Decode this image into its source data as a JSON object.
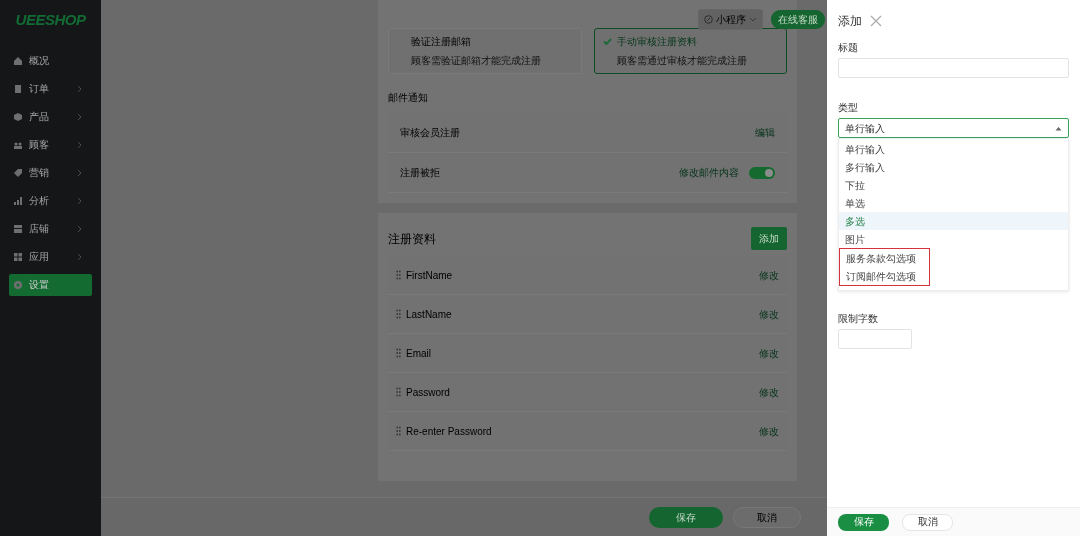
{
  "sidebar": {
    "logo": "UEESHOP",
    "items": [
      {
        "label": "概况",
        "expandable": false,
        "selected": false
      },
      {
        "label": "订单",
        "expandable": true,
        "selected": false
      },
      {
        "label": "产品",
        "expandable": true,
        "selected": false
      },
      {
        "label": "顾客",
        "expandable": true,
        "selected": false
      },
      {
        "label": "营销",
        "expandable": true,
        "selected": false
      },
      {
        "label": "分析",
        "expandable": true,
        "selected": false
      },
      {
        "label": "店铺",
        "expandable": true,
        "selected": false
      },
      {
        "label": "应用",
        "expandable": true,
        "selected": false
      },
      {
        "label": "设置",
        "expandable": false,
        "selected": true
      }
    ]
  },
  "top_bar": {
    "mini_program": "小程序",
    "online_button": "在线客服"
  },
  "review_options": [
    {
      "title": "验证注册邮箱",
      "description": "顾客需验证邮箱才能完成注册",
      "selected": false
    },
    {
      "title": "手动审核注册资料",
      "description": "顾客需通过审核才能完成注册",
      "selected": true
    }
  ],
  "email_notice": {
    "heading": "邮件通知",
    "rows": [
      {
        "label": "审核会员注册",
        "kind": "link",
        "action": "编辑"
      },
      {
        "label": "注册被拒",
        "kind": "toggle",
        "action": "修改邮件内容",
        "on": true
      }
    ]
  },
  "registration_fields": {
    "title": "注册资料",
    "add_button": "添加",
    "rows": [
      {
        "label": "FirstName",
        "action": "修改"
      },
      {
        "label": "LastName",
        "action": "修改"
      },
      {
        "label": "Email",
        "action": "修改"
      },
      {
        "label": "Password",
        "action": "修改"
      },
      {
        "label": "Re-enter Password",
        "action": "修改"
      }
    ]
  },
  "page_footer": {
    "save": "保存",
    "cancel": "取消"
  },
  "drawer": {
    "title": "添加",
    "fields": [
      {
        "label": "标题",
        "kind": "text"
      },
      {
        "label": "类型",
        "kind": "select",
        "value": "单行输入",
        "options": [
          {
            "label": "单行输入",
            "highlighted": false,
            "boxed": false
          },
          {
            "label": "多行输入",
            "highlighted": false,
            "boxed": false
          },
          {
            "label": "下拉",
            "highlighted": false,
            "boxed": false
          },
          {
            "label": "单选",
            "highlighted": false,
            "boxed": false
          },
          {
            "label": "多选",
            "highlighted": true,
            "boxed": false
          },
          {
            "label": "图片",
            "highlighted": false,
            "boxed": false
          },
          {
            "label": "服务条款勾选项",
            "highlighted": false,
            "boxed": true
          },
          {
            "label": "订阅邮件勾选项",
            "highlighted": false,
            "boxed": true
          }
        ]
      },
      {
        "label": "限制字数",
        "kind": "short"
      }
    ],
    "save": "保存",
    "cancel": "取消"
  }
}
